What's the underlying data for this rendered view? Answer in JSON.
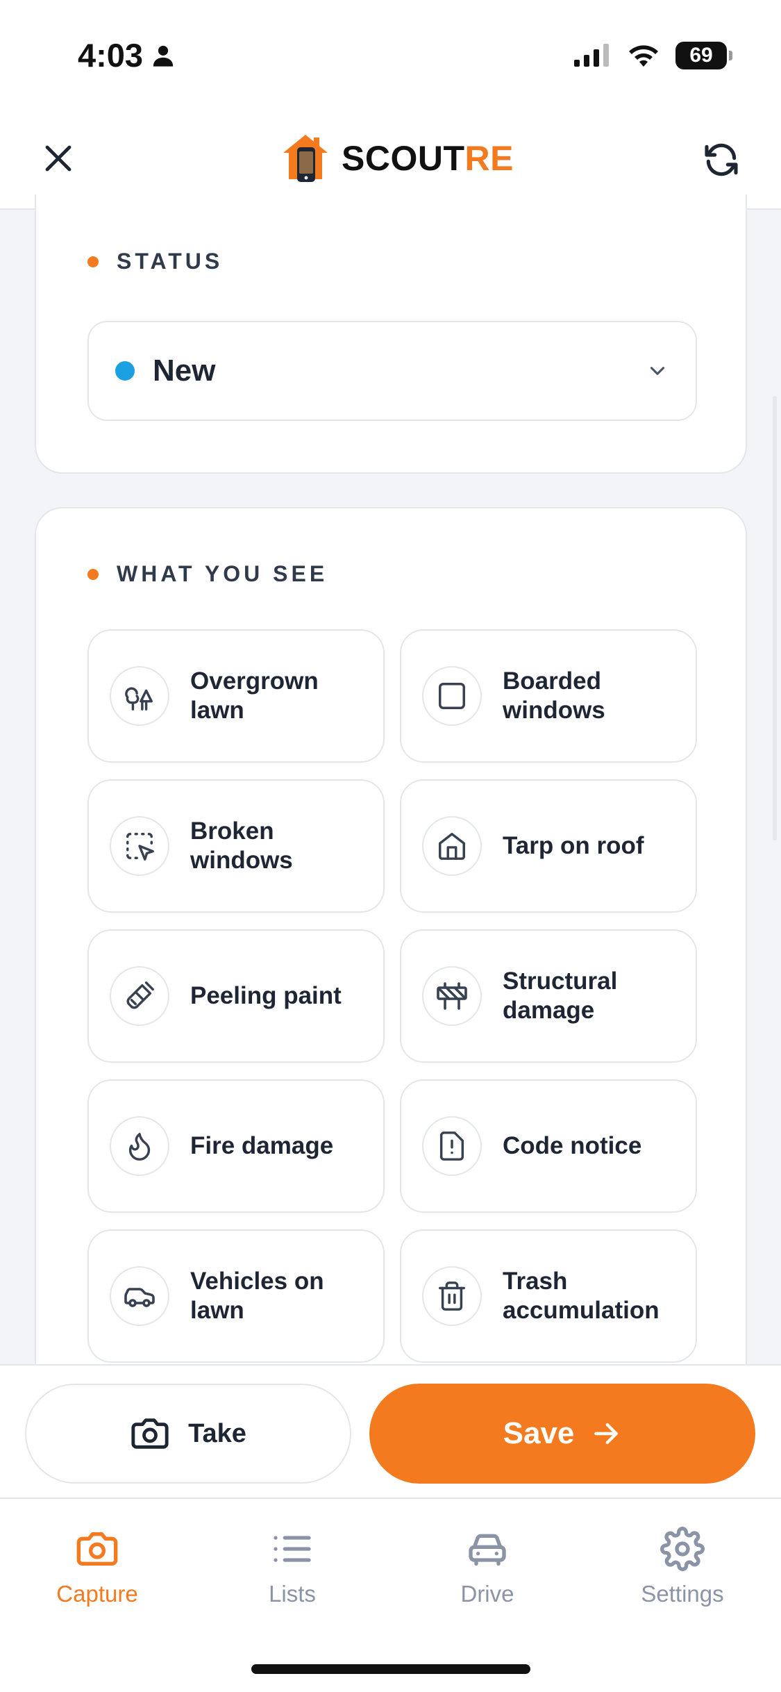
{
  "status_bar": {
    "time": "4:03",
    "battery": "69"
  },
  "header": {
    "logo": {
      "text_main": "SCOUT",
      "text_accent": "RE"
    },
    "close_icon": "close-icon",
    "refresh_icon": "refresh-icon"
  },
  "status_section": {
    "label": "STATUS",
    "selected": "New",
    "selected_color": "#1BA1E2"
  },
  "what_you_see": {
    "label": "WHAT YOU SEE",
    "options": [
      {
        "label": "Overgrown lawn",
        "icon": "trees-icon"
      },
      {
        "label": "Boarded windows",
        "icon": "square-icon"
      },
      {
        "label": "Broken windows",
        "icon": "dashed-square-pointer-icon"
      },
      {
        "label": "Tarp on roof",
        "icon": "house-icon"
      },
      {
        "label": "Peeling paint",
        "icon": "paintbrush-icon"
      },
      {
        "label": "Structural damage",
        "icon": "construction-barrier-icon"
      },
      {
        "label": "Fire damage",
        "icon": "flame-icon"
      },
      {
        "label": "Code notice",
        "icon": "alert-file-icon"
      },
      {
        "label": "Vehicles on lawn",
        "icon": "car-icon"
      },
      {
        "label": "Trash accumulation",
        "icon": "trash-icon"
      }
    ]
  },
  "actions": {
    "take_label": "Take",
    "save_label": "Save"
  },
  "tabs": [
    {
      "label": "Capture",
      "icon": "camera-icon",
      "active": true
    },
    {
      "label": "Lists",
      "icon": "list-icon",
      "active": false
    },
    {
      "label": "Drive",
      "icon": "car-icon",
      "active": false
    },
    {
      "label": "Settings",
      "icon": "gear-icon",
      "active": false
    }
  ],
  "colors": {
    "accent": "#F47A1F",
    "text": "#1E2533",
    "muted": "#8A94A6",
    "border": "#E3E6EB",
    "background": "#F2F4F7"
  }
}
